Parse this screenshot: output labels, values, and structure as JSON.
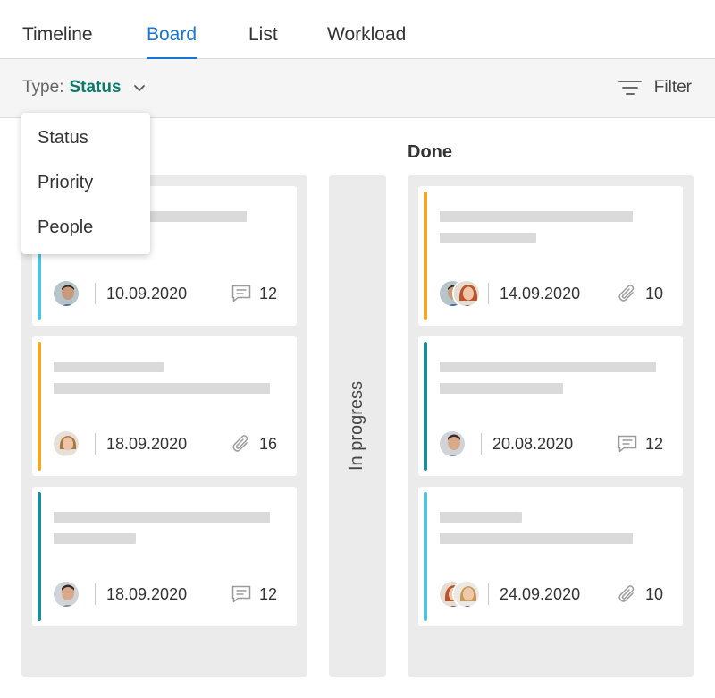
{
  "tabs": [
    {
      "label": "Timeline",
      "active": false
    },
    {
      "label": "Board",
      "active": true
    },
    {
      "label": "List",
      "active": false
    },
    {
      "label": "Workload",
      "active": false
    }
  ],
  "toolbar": {
    "type_label": "Type:",
    "type_value": "Status",
    "filter_label": "Filter"
  },
  "dropdown": {
    "options": [
      "Status",
      "Priority",
      "People"
    ]
  },
  "columns": {
    "collapsed_label": "In progress",
    "done_title": "Done"
  },
  "cards": [
    {
      "date": "10.09.2020",
      "meta_icon": "comment-icon",
      "count": "12",
      "stripe": "#4fc3dc"
    },
    {
      "date": "18.09.2020",
      "meta_icon": "attachment-icon",
      "count": "16",
      "stripe": "#f5a623"
    },
    {
      "date": "18.09.2020",
      "meta_icon": "comment-icon",
      "count": "12",
      "stripe": "#1b8a9a"
    },
    {
      "date": "14.09.2020",
      "meta_icon": "attachment-icon",
      "count": "10",
      "stripe": "#f5a623"
    },
    {
      "date": "20.08.2020",
      "meta_icon": "comment-icon",
      "count": "12",
      "stripe": "#1b8a9a"
    },
    {
      "date": "24.09.2020",
      "meta_icon": "attachment-icon",
      "count": "10",
      "stripe": "#4fc3dc"
    }
  ],
  "colors": {
    "accent": "#1976d2",
    "status_value": "#0b7a6a"
  }
}
